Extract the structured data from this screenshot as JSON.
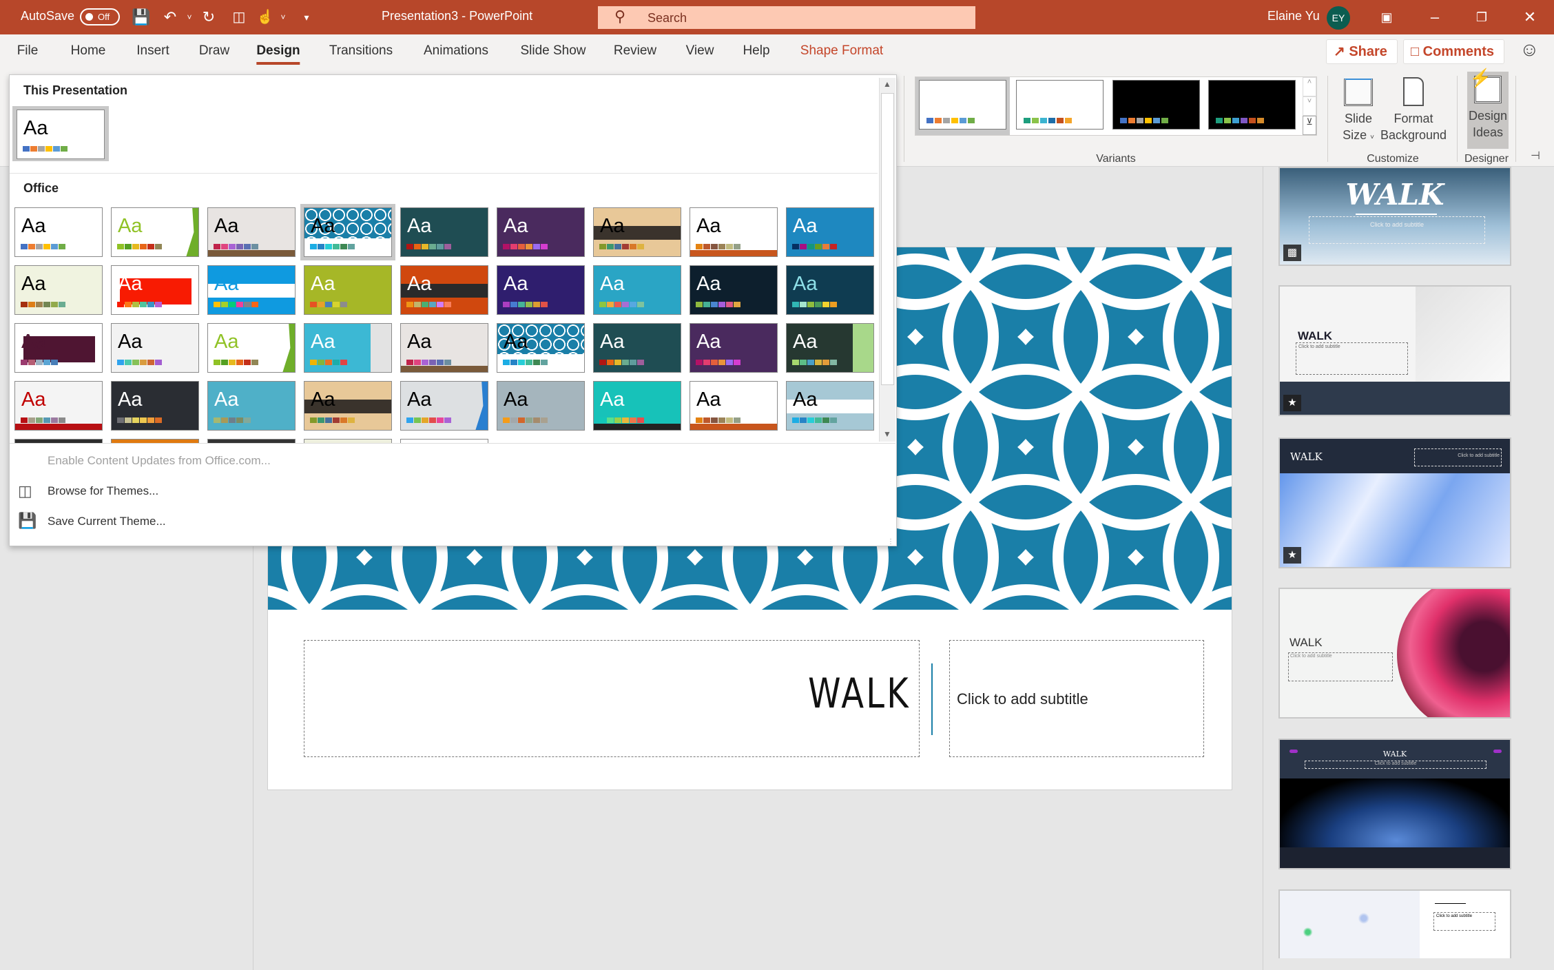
{
  "titlebar": {
    "autosave_label": "AutoSave",
    "autosave_state": "Off",
    "document_title": "Presentation3  -  PowerPoint",
    "search_placeholder": "Search",
    "user_name": "Elaine Yu",
    "user_initials": "EY",
    "icons": [
      "save-icon",
      "undo-icon",
      "redo-icon",
      "present-from-start-icon",
      "touch-mode-icon",
      "customize-qat-icon",
      "ribbon-display-icon",
      "minimize-icon",
      "restore-icon",
      "close-icon"
    ]
  },
  "tabs": [
    {
      "label": "File"
    },
    {
      "label": "Home"
    },
    {
      "label": "Insert"
    },
    {
      "label": "Draw"
    },
    {
      "label": "Design",
      "active": true
    },
    {
      "label": "Transitions"
    },
    {
      "label": "Animations"
    },
    {
      "label": "Slide Show"
    },
    {
      "label": "Review"
    },
    {
      "label": "View"
    },
    {
      "label": "Help"
    },
    {
      "label": "Shape Format",
      "contextual": true
    }
  ],
  "actions": {
    "share": "Share",
    "comments": "Comments"
  },
  "ribbon": {
    "variants_label": "Variants",
    "variants": [
      {
        "bg": "#ffffff",
        "swatches": [
          "#4472c4",
          "#ed7d31",
          "#a5a5a5",
          "#ffc000",
          "#5b9bd5",
          "#70ad47"
        ],
        "selected": true
      },
      {
        "bg": "#ffffff",
        "swatches": [
          "#1e9e7e",
          "#8bc34a",
          "#3cb4d0",
          "#1f6ea8",
          "#c4501d",
          "#f4a52a"
        ]
      },
      {
        "bg": "#000000",
        "swatches": [
          "#4472c4",
          "#ed7d31",
          "#a5a5a5",
          "#ffc000",
          "#5b9bd5",
          "#70ad47"
        ]
      },
      {
        "bg": "#000000",
        "swatches": [
          "#1e9e7e",
          "#8bc34a",
          "#3c9ed0",
          "#7e57c2",
          "#c4501d",
          "#d68b2a"
        ]
      }
    ],
    "customize_label": "Customize",
    "slide_size": [
      "Slide",
      "Size"
    ],
    "format_background": [
      "Format",
      "Background"
    ],
    "designer_label": "Designer",
    "design_ideas": [
      "Design",
      "Ideas"
    ]
  },
  "theme_gallery": {
    "this_presentation_heading": "This Presentation",
    "current_theme": {
      "bg": "#ffffff",
      "fg": "#000000",
      "sw": [
        "#4472c4",
        "#ed7d31",
        "#a5a5a5",
        "#ffc000",
        "#5b9bd5",
        "#70ad47"
      ]
    },
    "office_heading": "Office",
    "sample_text": "Aa",
    "selected_index": 3,
    "themes": [
      {
        "bg": "#ffffff",
        "fg": "#000000",
        "sw": [
          "#4472c4",
          "#ed7d31",
          "#a5a5a5",
          "#ffc000",
          "#5b9bd5",
          "#70ad47"
        ]
      },
      {
        "bg": "#ffffff",
        "fg": "#90c226",
        "accent": "#6fae2a",
        "sw": [
          "#90c226",
          "#54a021",
          "#e6b91e",
          "#e76618",
          "#c42f1a",
          "#918655"
        ]
      },
      {
        "bg": "#e8e4e2",
        "fg": "#000000",
        "floor": "#7a5a3a",
        "sw": [
          "#c0234a",
          "#e0447f",
          "#a962d4",
          "#7a63b4",
          "#5a6fb3",
          "#6c8fa1"
        ]
      },
      {
        "bg": "#1a7fa8",
        "fg": "#000000",
        "pattern": true,
        "sw": [
          "#1cade4",
          "#2683c6",
          "#27ced7",
          "#42ba97",
          "#3e8853",
          "#62a39f"
        ]
      },
      {
        "bg": "#1f4d53",
        "fg": "#ffffff",
        "sw": [
          "#b01513",
          "#ea6312",
          "#e6b729",
          "#6aac90",
          "#5f9c9d",
          "#9e5e9b"
        ]
      },
      {
        "bg": "#4a2a5e",
        "fg": "#ffffff",
        "sw": [
          "#b31166",
          "#e33d6f",
          "#e45f3c",
          "#e9943a",
          "#9b6bf2",
          "#d53dd0"
        ]
      },
      {
        "bg": "#e8c898",
        "fg": "#000000",
        "band": "#3a332c",
        "sw": [
          "#83992a",
          "#3c9770",
          "#44709d",
          "#a23c33",
          "#d97828",
          "#deb340"
        ]
      },
      {
        "bg": "#ffffff",
        "fg": "#000000",
        "floor": "#c8561d",
        "sw": [
          "#e48312",
          "#bd582c",
          "#865640",
          "#9b8357",
          "#c2bc80",
          "#94a088"
        ]
      },
      {
        "bg": "#1e88c0",
        "fg": "#ffffff",
        "sw": [
          "#052f61",
          "#a50e82",
          "#14967c",
          "#6a9e1f",
          "#e87d37",
          "#c62324"
        ]
      },
      {
        "bg": "#f0f3e0",
        "fg": "#000000",
        "sw": [
          "#a53010",
          "#de7e18",
          "#9f8351",
          "#728653",
          "#92aa4c",
          "#6aac91"
        ]
      },
      {
        "bg": "#ffffff",
        "fg": "#ffffff",
        "block": "#f81b02",
        "sw": [
          "#f81b02",
          "#fc7715",
          "#afbf41",
          "#50c49f",
          "#3b95c4",
          "#b560d4"
        ]
      },
      {
        "bg": "#0f9ae0",
        "fg": "#0f9ae0",
        "band": "#ffffff",
        "sw": [
          "#ffc000",
          "#a5d028",
          "#08cc78",
          "#f24099",
          "#828288",
          "#f56617"
        ]
      },
      {
        "bg": "#a6b727",
        "fg": "#ffffff",
        "sw": [
          "#e65223",
          "#e8a02b",
          "#4a7fb8",
          "#d6d32f",
          "#8c8c8c"
        ]
      },
      {
        "bg": "#d0480e",
        "fg": "#ffffff",
        "band": "#2a2a2a",
        "sw": [
          "#f09415",
          "#c1b56b",
          "#4baf73",
          "#5aa6c0",
          "#d17df9",
          "#fa7e5c"
        ]
      },
      {
        "bg": "#2f1e6e",
        "fg": "#ffffff",
        "sw": [
          "#ac3ec1",
          "#477bd1",
          "#46b298",
          "#90ba4c",
          "#dd9d31",
          "#e25247"
        ]
      },
      {
        "bg": "#2aa5c5",
        "fg": "#ffffff",
        "sw": [
          "#8ec641",
          "#f2a93b",
          "#ea5a4f",
          "#a86ed4",
          "#57a8e0",
          "#7fc39d"
        ]
      },
      {
        "bg": "#0d1f2d",
        "fg": "#ffffff",
        "sw": [
          "#8fb93e",
          "#46b195",
          "#4a86d0",
          "#a45ddb",
          "#db5787",
          "#e0a540"
        ]
      },
      {
        "bg": "#0f3c51",
        "fg": "#8ee0e8",
        "sw": [
          "#31b6b5",
          "#a4e5cf",
          "#8fbd3e",
          "#4a9c5a",
          "#f4d42e",
          "#ed9e22"
        ]
      },
      {
        "bg": "#ffffff",
        "fg": "#4f1532",
        "block": "#4f1532",
        "sw": [
          "#9a3a6e",
          "#b55d73",
          "#9db2c3",
          "#5aa5d4",
          "#487eb8"
        ]
      },
      {
        "bg": "#f2f2f2",
        "fg": "#000000",
        "sw": [
          "#2fa3ee",
          "#4bcaad",
          "#86c157",
          "#d99c3f",
          "#ce6633",
          "#a35dd1"
        ]
      },
      {
        "bg": "#ffffff",
        "fg": "#90c226",
        "accent": "#6fae2a",
        "sw": [
          "#90c226",
          "#54a021",
          "#e6b91e",
          "#e76618",
          "#c42f1a",
          "#918655"
        ]
      },
      {
        "bg": "#3cb8d4",
        "fg": "#ffffff",
        "side": "#e3e3e3",
        "sw": [
          "#f0b400",
          "#84b53c",
          "#e97025",
          "#1cadaa",
          "#e14545"
        ]
      },
      {
        "bg": "#e8e4e2",
        "fg": "#000000",
        "floor": "#7a5a3a",
        "sw": [
          "#c0234a",
          "#e0447f",
          "#a962d4",
          "#7a63b4",
          "#5a6fb3",
          "#6c8fa1"
        ]
      },
      {
        "bg": "#1a7fa8",
        "fg": "#000000",
        "pattern": true,
        "sw": [
          "#1cade4",
          "#2683c6",
          "#27ced7",
          "#42ba97",
          "#3e8853",
          "#62a39f"
        ]
      },
      {
        "bg": "#1f4d53",
        "fg": "#ffffff",
        "sw": [
          "#b01513",
          "#ea6312",
          "#e6b729",
          "#6aac90",
          "#5f9c9d",
          "#9e5e9b"
        ]
      },
      {
        "bg": "#4a2a5e",
        "fg": "#ffffff",
        "sw": [
          "#b31166",
          "#e33d6f",
          "#e45f3c",
          "#e9943a",
          "#9b6bf2",
          "#d53dd0"
        ]
      },
      {
        "bg": "#263831",
        "fg": "#ffffff",
        "side": "#a8d88a",
        "sw": [
          "#a6d86f",
          "#5dbf87",
          "#4a9fc7",
          "#d9b540",
          "#e39b3a",
          "#83b8a4"
        ]
      },
      {
        "bg": "#f4f4f4",
        "fg": "#c00000",
        "floor": "#b81014",
        "sw": [
          "#b81014",
          "#a7a08a",
          "#84a878",
          "#5599b3",
          "#9b7aa0",
          "#8a8a8a"
        ]
      },
      {
        "bg": "#2a2d33",
        "fg": "#ffffff",
        "sw": [
          "#6f6f74",
          "#c7c193",
          "#e6d45e",
          "#eec74f",
          "#f09d3a",
          "#db6b24"
        ]
      },
      {
        "bg": "#4fb0c8",
        "fg": "#ffffff",
        "sw": [
          "#a5b871",
          "#a89a58",
          "#6d7f8c",
          "#7d8c64",
          "#83a99a"
        ]
      },
      {
        "bg": "#e8c898",
        "fg": "#000000",
        "band": "#3a332c",
        "sw": [
          "#83992a",
          "#3c9770",
          "#44709d",
          "#a23c33",
          "#d97828",
          "#deb340"
        ]
      },
      {
        "bg": "#dde0e2",
        "fg": "#000000",
        "accent": "#2a7fd0",
        "sw": [
          "#2fa3ee",
          "#76c453",
          "#e4a629",
          "#e34c4c",
          "#e8479a",
          "#a963d6"
        ]
      },
      {
        "bg": "#a5b5bd",
        "fg": "#000000",
        "sw": [
          "#f49c19",
          "#a3a8ab",
          "#d3672b",
          "#8fa58b",
          "#a58b6c",
          "#a9a190"
        ]
      },
      {
        "bg": "#17c2b9",
        "fg": "#ffffff",
        "floor": "#222222",
        "sw": [
          "#13c7b9",
          "#59e08d",
          "#9ad04b",
          "#e9b63a",
          "#f0764a",
          "#e84c4c"
        ]
      },
      {
        "bg": "#ffffff",
        "fg": "#000000",
        "floor": "#c8561d",
        "sw": [
          "#e48312",
          "#bd582c",
          "#865640",
          "#9b8357",
          "#c2bc80",
          "#94a088"
        ]
      },
      {
        "bg": "#a6c8d5",
        "fg": "#000000",
        "band": "#ffffff",
        "sw": [
          "#1cade4",
          "#2683c6",
          "#27ced7",
          "#42ba97",
          "#3e8853",
          "#62a39f"
        ]
      },
      {
        "bg": "#2d2d2d",
        "fg": "#ffffff",
        "sw": []
      },
      {
        "bg": "#e07a10",
        "fg": "#ffffff",
        "sw": []
      },
      {
        "bg": "#333333",
        "fg": "#ffffff",
        "sw": []
      },
      {
        "bg": "#eef0de",
        "fg": "#000000",
        "sw": []
      },
      {
        "bg": "#ffffff",
        "fg": "#000000",
        "sw": []
      }
    ],
    "menu": [
      {
        "label": "Enable Content Updates from Office.com...",
        "disabled": true
      },
      {
        "label": "Browse for Themes...",
        "icon": "browse-themes-icon"
      },
      {
        "label": "Save Current Theme...",
        "icon": "save-theme-icon"
      }
    ]
  },
  "slide": {
    "title": "WALK",
    "subtitle_placeholder": "Click to add subtitle",
    "pattern_color": "#1a7fa8"
  },
  "designer": {
    "ideas": [
      {
        "title": "WALK",
        "subtitle": "Click to add subtitle",
        "badge": "video-icon"
      },
      {
        "title": "WALK",
        "subtitle": "Click to add subtitle",
        "badge": "star-icon"
      },
      {
        "title": "WALK",
        "subtitle": "Click to add subtitle",
        "badge": "star-icon"
      },
      {
        "title": "WALK",
        "subtitle": "Click to add subtitle"
      },
      {
        "title": "WALK",
        "subtitle": "Click to add subtitle"
      },
      {
        "subtitle": "Click to add subtitle"
      }
    ]
  }
}
